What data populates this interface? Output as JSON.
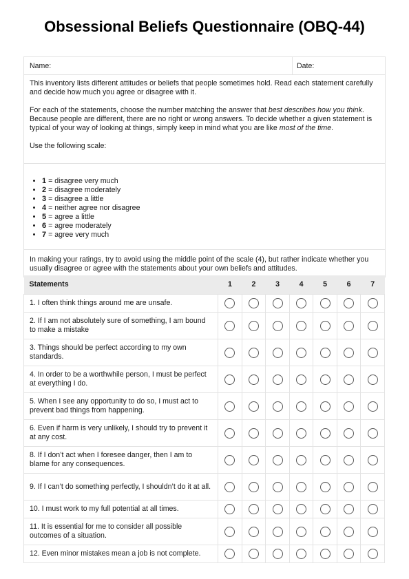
{
  "title": "Obsessional Beliefs Questionnaire (OBQ-44)",
  "form": {
    "name_label": "Name:",
    "name_value": "",
    "date_label": "Date:",
    "date_value": ""
  },
  "instructions": {
    "p1": "This inventory lists different attitudes or beliefs that people sometimes hold. Read each statement carefully and decide how much you agree or disagree with it.",
    "p2_a": "For each of the statements, choose the number matching the answer that ",
    "p2_em1": "best describes how you think",
    "p2_b": ". Because people are different, there are no right or wrong answers. To decide whether a given statement is typical of your way of looking at things, simply keep in mind what you are like ",
    "p2_em2": "most of the time",
    "p2_c": ".",
    "p3": "Use the following scale:",
    "note": "In making your ratings, try to avoid using the middle point of the scale (4), but rather indicate whether you usually disagree or agree with the statements about your own beliefs and attitudes."
  },
  "scale": [
    {
      "num": "1",
      "text": " = disagree very much"
    },
    {
      "num": "2",
      "text": " = disagree moderately"
    },
    {
      "num": "3",
      "text": " = disagree a little"
    },
    {
      "num": "4",
      "text": " = neither agree nor disagree"
    },
    {
      "num": "5",
      "text": " = agree a little"
    },
    {
      "num": "6",
      "text": " = agree moderately"
    },
    {
      "num": "7",
      "text": " = agree very much"
    }
  ],
  "table": {
    "header": "Statements",
    "columns": [
      "1",
      "2",
      "3",
      "4",
      "5",
      "6",
      "7"
    ],
    "rows": [
      {
        "text": "1. I often think things around me are unsafe.",
        "selected": null
      },
      {
        "text": "2. If I am not absolutely sure of something, I am bound to make a mistake",
        "selected": null
      },
      {
        "text": "3. Things should be perfect according to my own standards.",
        "selected": null
      },
      {
        "text": "4. In order to be a worthwhile person, I must be perfect at everything I do.",
        "selected": null
      },
      {
        "text": "5. When I see any opportunity to do so, I must act to prevent bad things from happening.",
        "selected": null
      },
      {
        "text": "6. Even if harm is very unlikely, I should try to prevent it at any cost.",
        "selected": null
      },
      {
        "text": "8. If I don’t act when I foresee danger, then I am to blame for any consequences.",
        "selected": null
      },
      {
        "text": "9. If I can’t do something perfectly, I shouldn’t do it at all.",
        "selected": null
      },
      {
        "text": "10. I must work to my full potential at all times.",
        "selected": null
      },
      {
        "text": "11. It is essential for me to consider all possible outcomes of a situation.",
        "selected": null
      },
      {
        "text": "12. Even minor mistakes mean a job is not complete.",
        "selected": null
      }
    ]
  }
}
